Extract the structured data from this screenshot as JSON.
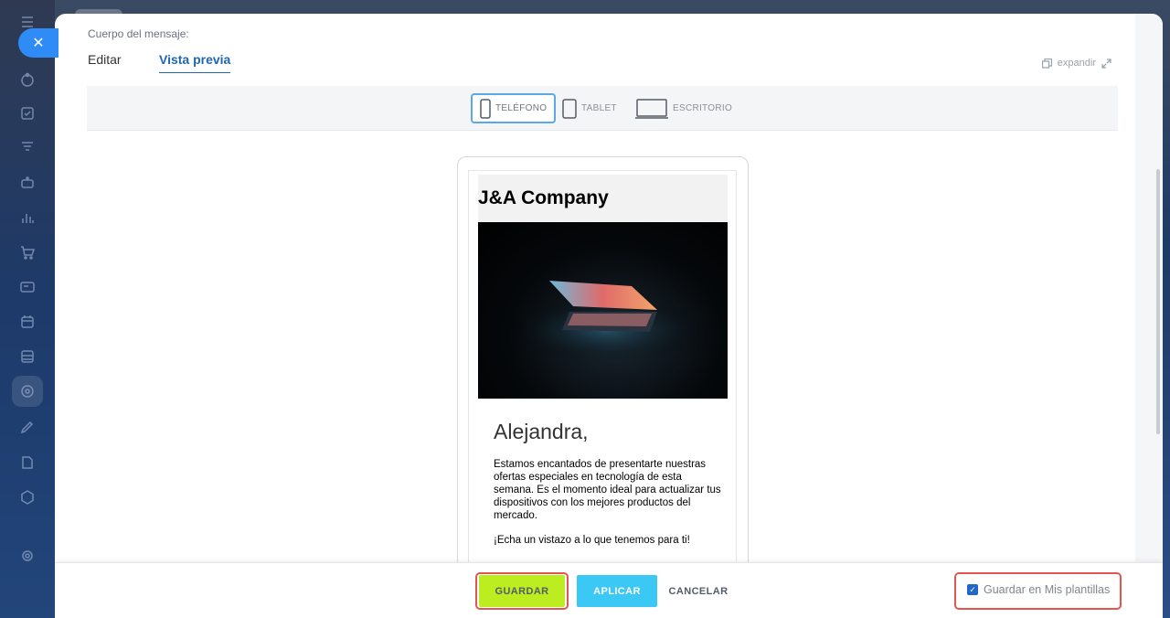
{
  "panel": {
    "body_label": "Cuerpo del mensaje:",
    "tabs": [
      {
        "label": "Editar"
      },
      {
        "label": "Vista previa",
        "active": true
      }
    ],
    "expand_label": "expandir"
  },
  "devices": {
    "phone": "TELÉFONO",
    "tablet": "TABLET",
    "desktop": "ESCRITORIO",
    "selected": "phone"
  },
  "email": {
    "company": "J&A Company",
    "greeting": "Alejandra,",
    "paragraph": "Estamos encantados de presentarte nuestras ofertas especiales en tecnología de esta semana. Es el momento ideal para actualizar tus dispositivos con los mejores productos del mercado.",
    "paragraph2": "¡Echa un vistazo a lo que tenemos para ti!"
  },
  "footer": {
    "save": "GUARDAR",
    "apply": "APLICAR",
    "cancel": "CANCELAR",
    "save_template": "Guardar en Mis plantillas",
    "save_template_checked": true
  },
  "colors": {
    "accent": "#2067c9",
    "save_button": "#bbed21",
    "apply_button": "#3bc8f5",
    "highlight": "#e2564f"
  }
}
